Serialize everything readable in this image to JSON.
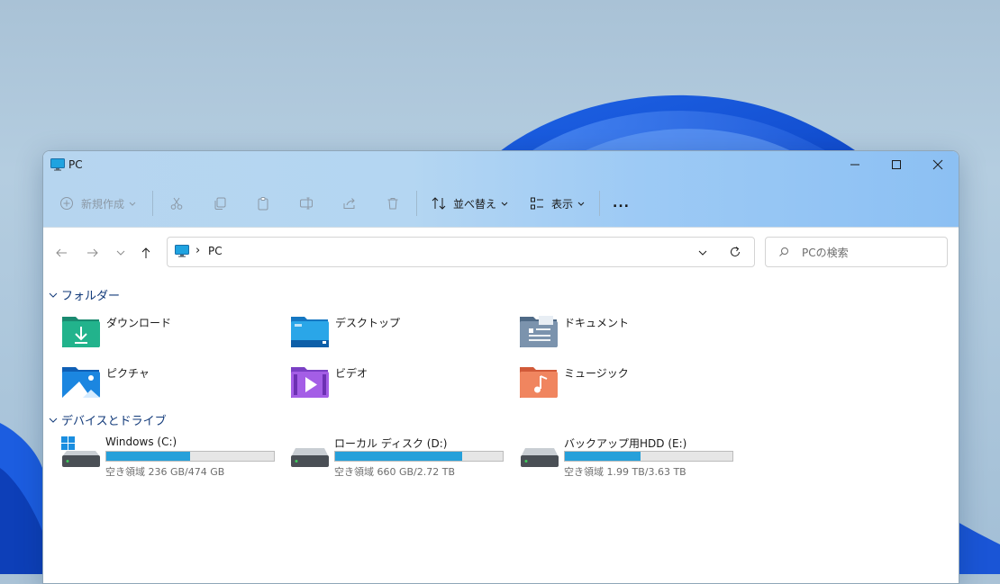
{
  "window": {
    "title": "PC"
  },
  "toolbar": {
    "new_label": "新規作成",
    "sort_label": "並べ替え",
    "view_label": "表示",
    "more_label": "..."
  },
  "address": {
    "path": "PC",
    "separator": "›"
  },
  "search": {
    "placeholder": "PCの検索"
  },
  "sections": {
    "folders": "フォルダー",
    "devices": "デバイスとドライブ"
  },
  "folders": [
    {
      "label": "ダウンロード",
      "icon": "downloads-folder-icon"
    },
    {
      "label": "デスクトップ",
      "icon": "desktop-folder-icon"
    },
    {
      "label": "ドキュメント",
      "icon": "documents-folder-icon"
    },
    {
      "label": "ピクチャ",
      "icon": "pictures-folder-icon"
    },
    {
      "label": "ビデオ",
      "icon": "videos-folder-icon"
    },
    {
      "label": "ミュージック",
      "icon": "music-folder-icon"
    }
  ],
  "drives": [
    {
      "name": "Windows (C:)",
      "free": "空き領域 236 GB/474 GB",
      "used_fraction": 0.5
    },
    {
      "name": "ローカル ディスク (D:)",
      "free": "空き領域 660 GB/2.72 TB",
      "used_fraction": 0.76
    },
    {
      "name": "バックアップ用HDD (E:)",
      "free": "空き領域 1.99 TB/3.63 TB",
      "used_fraction": 0.45
    }
  ],
  "colors": {
    "accent": "#26a0da",
    "section_heading": "#123a7a",
    "mica": "#b4d6f2"
  }
}
